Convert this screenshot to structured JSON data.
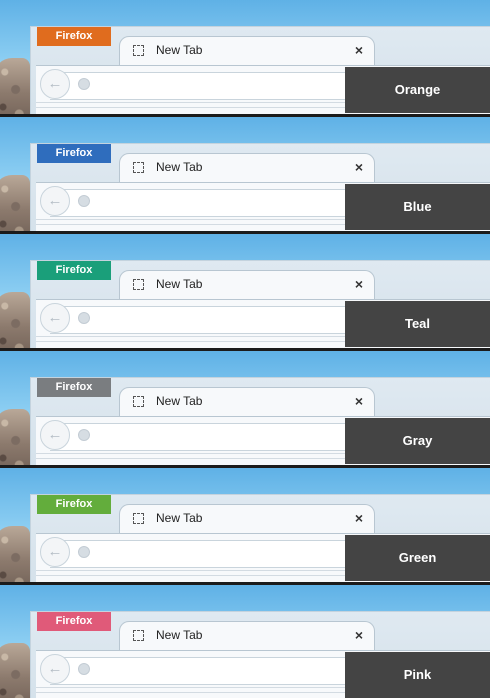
{
  "strips": [
    {
      "badge": "Firefox",
      "tab_title": "New Tab",
      "close": "×",
      "label": "Orange",
      "color": "#e06c1e"
    },
    {
      "badge": "Firefox",
      "tab_title": "New Tab",
      "close": "×",
      "label": "Blue",
      "color": "#2f6dbd"
    },
    {
      "badge": "Firefox",
      "tab_title": "New Tab",
      "close": "×",
      "label": "Teal",
      "color": "#1a9f7a"
    },
    {
      "badge": "Firefox",
      "tab_title": "New Tab",
      "close": "×",
      "label": "Gray",
      "color": "#7a7d80"
    },
    {
      "badge": "Firefox",
      "tab_title": "New Tab",
      "close": "×",
      "label": "Green",
      "color": "#63ad3c"
    },
    {
      "badge": "Firefox",
      "tab_title": "New Tab",
      "close": "×",
      "label": "Pink",
      "color": "#e05a79"
    }
  ],
  "icons": {
    "back": "back-arrow-icon",
    "tab": "new-tab-icon",
    "site": "globe-icon",
    "close": "close-icon"
  }
}
